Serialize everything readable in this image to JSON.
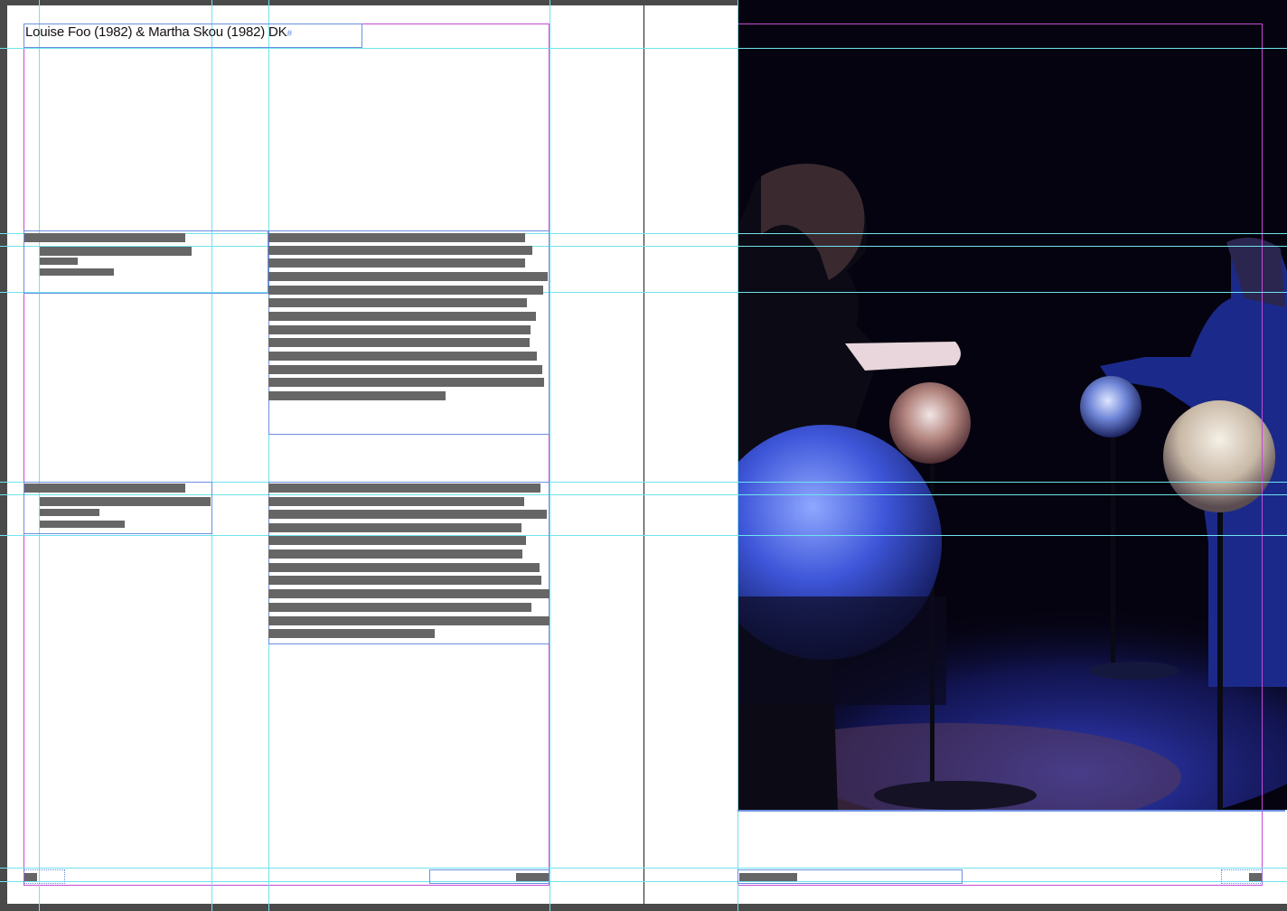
{
  "document": {
    "heading": "Louise Foo (1982) & Martha Skou (1982) DK",
    "heading_mark": "#"
  },
  "placeholders": {
    "description": "Greeked text lines (text rendered as grey bars at this zoom)"
  },
  "colors": {
    "pasteboard": "#4a4a4a",
    "page": "#ffffff",
    "margin_guide": "#c64ad6",
    "column_guide": "#6fe3ee",
    "frame_edge": "#6b8fe0",
    "greeked_text": "#666666"
  },
  "photo": {
    "subject": "performers-with-illuminated-spheres"
  }
}
